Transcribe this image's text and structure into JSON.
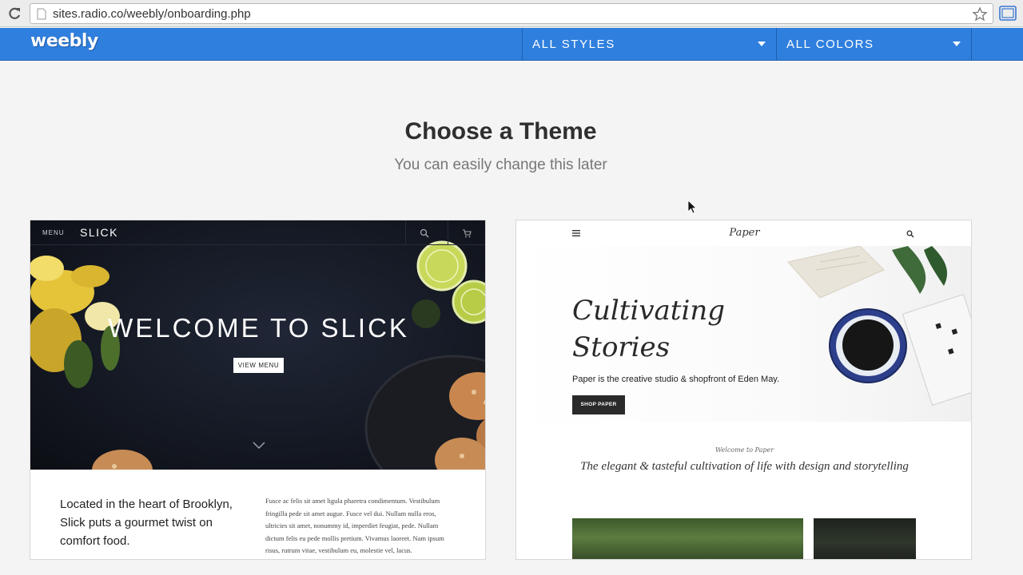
{
  "browser": {
    "url": "sites.radio.co/weebly/onboarding.php"
  },
  "header": {
    "logo": "weebly",
    "styles_label": "ALL STYLES",
    "colors_label": "ALL COLORS",
    "accent_color": "#2f7fde"
  },
  "main": {
    "title": "Choose a Theme",
    "subtitle": "You can easily change this later"
  },
  "themes": {
    "slick": {
      "nav_menu": "MENU",
      "brand": "SLICK",
      "headline": "WELCOME TO SLICK",
      "button": "VIEW MENU",
      "body_left": "Located in the heart of Brooklyn, Slick puts a gourmet twist on comfort food.",
      "body_right": "Fusce ac felis sit amet ligula pharetra condimentum. Vestibulum fringilla pede sit amet augue. Fusce vel dui. Nullam nulla eros, ultricies sit amet, nonummy id, imperdiet feugiat, pede. Nullam dictum felis eu pede mollis pretium. Vivamus laoreet. Nam ipsum risus, rutrum vitae, vestibulum eu, molestie vel, lacus."
    },
    "paper": {
      "brand": "Paper",
      "headline": "Cultivating Stories",
      "tagline": "Paper is the creative studio & shopfront of Eden May.",
      "button": "SHOP PAPER",
      "welcome": "Welcome to Paper",
      "elegant": "The elegant & tasteful cultivation of life with design and storytelling"
    }
  }
}
